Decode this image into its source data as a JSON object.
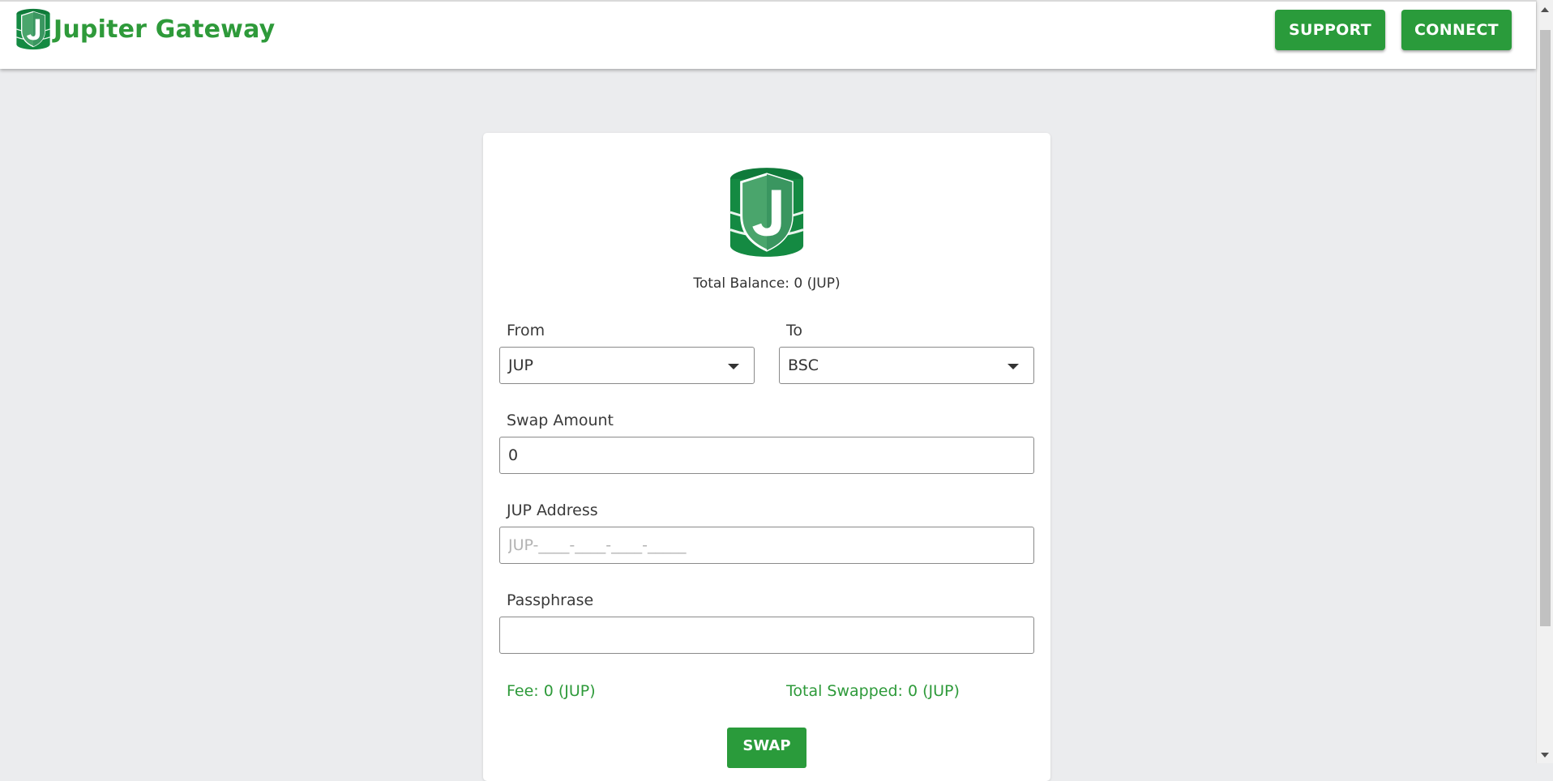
{
  "header": {
    "brand_icon": "jupiter-shield-logo-icon",
    "title": "Jupiter Gateway",
    "support_label": "SUPPORT",
    "connect_label": "CONNECT"
  },
  "card": {
    "logo_icon": "jupiter-shield-logo-icon",
    "total_balance": "Total Balance: 0 (JUP)",
    "from": {
      "label": "From",
      "value": "JUP"
    },
    "to": {
      "label": "To",
      "value": "BSC"
    },
    "swap_amount": {
      "label": "Swap Amount",
      "value": "0"
    },
    "jup_address": {
      "label": "JUP Address",
      "value": "",
      "placeholder": "JUP-____-____-____-_____"
    },
    "passphrase": {
      "label": "Passphrase",
      "value": ""
    },
    "fee": "Fee: 0 (JUP)",
    "total_swapped": "Total Swapped: 0 (JUP)",
    "swap_label": "SWAP"
  },
  "colors": {
    "brand_green": "#2e9a3a",
    "button_green": "#2a9b3b",
    "background": "#ebecee"
  }
}
